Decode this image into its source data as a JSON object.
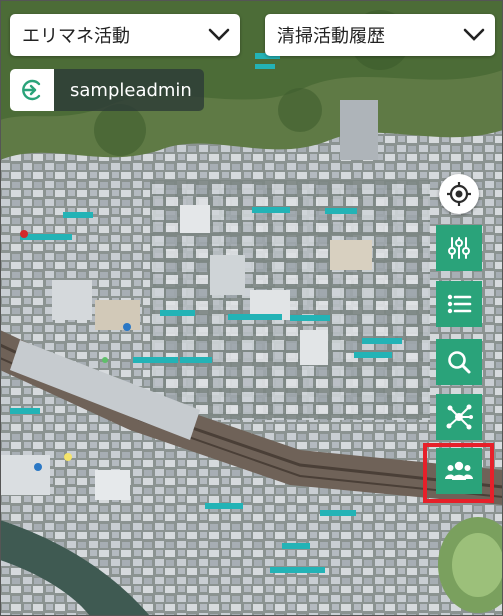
{
  "header": {
    "area_dropdown": {
      "selected": "エリマネ活動"
    },
    "history_dropdown": {
      "selected": "清掃活動履歴"
    }
  },
  "user": {
    "name": "sampleadmin"
  },
  "toolbar": {
    "buttons": [
      {
        "icon": "locate-icon"
      },
      {
        "icon": "filter-sliders-icon"
      },
      {
        "icon": "list-icon"
      },
      {
        "icon": "search-icon"
      },
      {
        "icon": "network-icon"
      },
      {
        "icon": "users-icon",
        "highlighted": true
      }
    ]
  },
  "colors": {
    "accent": "#2aa37a",
    "highlight": "#e6202a",
    "label_tag": "#23b3b6"
  }
}
